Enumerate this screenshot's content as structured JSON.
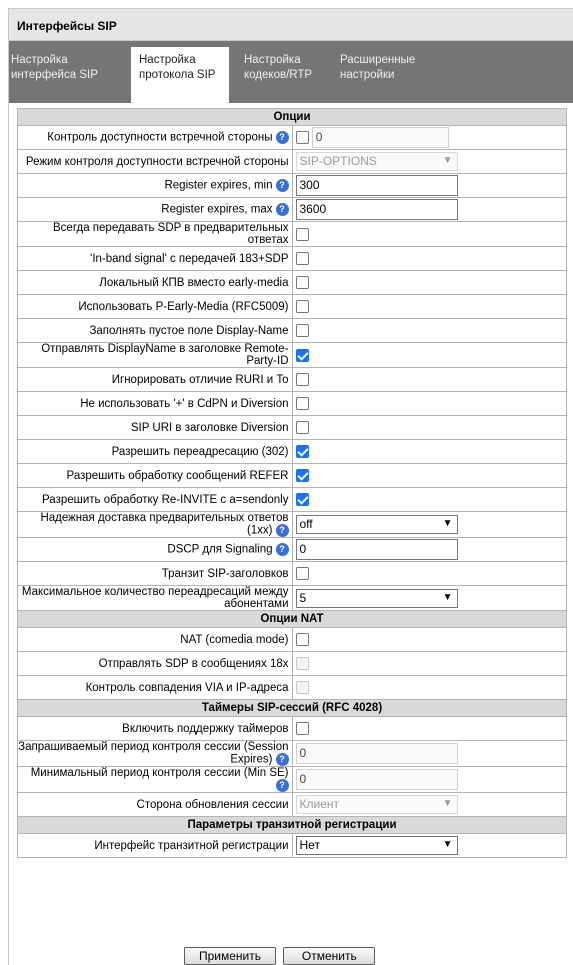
{
  "window": {
    "title": "Интерфейсы SIP"
  },
  "tabs": [
    {
      "line1": "Настройка",
      "line2": "интерфейса SIP"
    },
    {
      "line1": "Настройка",
      "line2": "протокола SIP"
    },
    {
      "line1": "Настройка",
      "line2": "кодеков/RTP"
    },
    {
      "line1": "Расширенные",
      "line2": "настройки"
    }
  ],
  "active_tab": 1,
  "sections": {
    "options": "Опции",
    "nat": "Опции NAT",
    "timers": "Таймеры SIP-сессий (RFC 4028)",
    "transit": "Параметры транзитной регистрации"
  },
  "rows": {
    "remote_control": {
      "label": "Контроль доступности встречной стороны",
      "checked": false,
      "value": "0"
    },
    "remote_mode": {
      "label": "Режим контроля доступности встречной стороны",
      "value": "SIP-OPTIONS"
    },
    "reg_min": {
      "label": "Register expires, min",
      "value": "300"
    },
    "reg_max": {
      "label": "Register expires, max",
      "value": "3600"
    },
    "sdp_prelim": {
      "label": "Всегда передавать SDP в предварительных ответах",
      "checked": false
    },
    "inband": {
      "label": "'In-band signal' с передачей 183+SDP",
      "checked": false
    },
    "local_kpv": {
      "label": "Локальный КПВ вместо early-media",
      "checked": false
    },
    "p_early": {
      "label": "Использовать P-Early-Media (RFC5009)",
      "checked": false
    },
    "display_name": {
      "label": "Заполнять пустое поле Display-Name",
      "checked": false
    },
    "rpid": {
      "label": "Отправлять DisplayName в заголовке Remote-Party-ID",
      "checked": true
    },
    "ruri": {
      "label": "Игнорировать отличие RURI и To",
      "checked": false
    },
    "no_plus": {
      "label": "Не использовать '+' в CdPN и Diversion",
      "checked": false
    },
    "sip_uri": {
      "label": "SIP URI в заголовке Diversion",
      "checked": false
    },
    "redirect": {
      "label": "Разрешить переадресацию (302)",
      "checked": true
    },
    "refer": {
      "label": "Разрешить обработку сообщений REFER",
      "checked": true
    },
    "reinvite": {
      "label": "Разрешить обработку Re-INVITE с a=sendonly",
      "checked": true
    },
    "reliable": {
      "label": "Надежная доставка предварительных ответов (1xx)",
      "value": "off"
    },
    "dscp": {
      "label": "DSCP для Signaling",
      "value": "0"
    },
    "transit_hdr": {
      "label": "Транзит SIP-заголовков",
      "checked": false
    },
    "max_redirect": {
      "label": "Максимальное количество переадресаций между абонентами",
      "value": "5"
    },
    "nat_mode": {
      "label": "NAT (comedia mode)",
      "checked": false
    },
    "sdp_18x": {
      "label": "Отправлять SDP в сообщениях 18x",
      "checked": false
    },
    "via_ip": {
      "label": "Контроль совпадения VIA и IP-адреса",
      "checked": false
    },
    "timers_on": {
      "label": "Включить поддержку таймеров",
      "checked": false
    },
    "session_exp": {
      "label": "Запрашиваемый период контроля сессии (Session Expires)",
      "value": "0"
    },
    "min_se": {
      "label": "Минимальный период контроля сессии (Min SE)",
      "value": "0"
    },
    "refresher": {
      "label": "Сторона обновления сессии",
      "value": "Клиент"
    },
    "transit_iface": {
      "label": "Интерфейс транзитной регистрации",
      "value": "Нет"
    }
  },
  "help_glyph": "?",
  "arrow_glyph": "▼",
  "buttons": {
    "apply": "Применить",
    "cancel": "Отменить"
  },
  "icons": {
    "help": "help-icon",
    "dropdown": "chevron-down-icon",
    "check": "checkmark-icon"
  },
  "colors": {
    "tab_bar": "#757575",
    "header_bg": "#d9d9d9",
    "check_blue": "#1a73e8",
    "help_blue": "#3b6fd6"
  }
}
